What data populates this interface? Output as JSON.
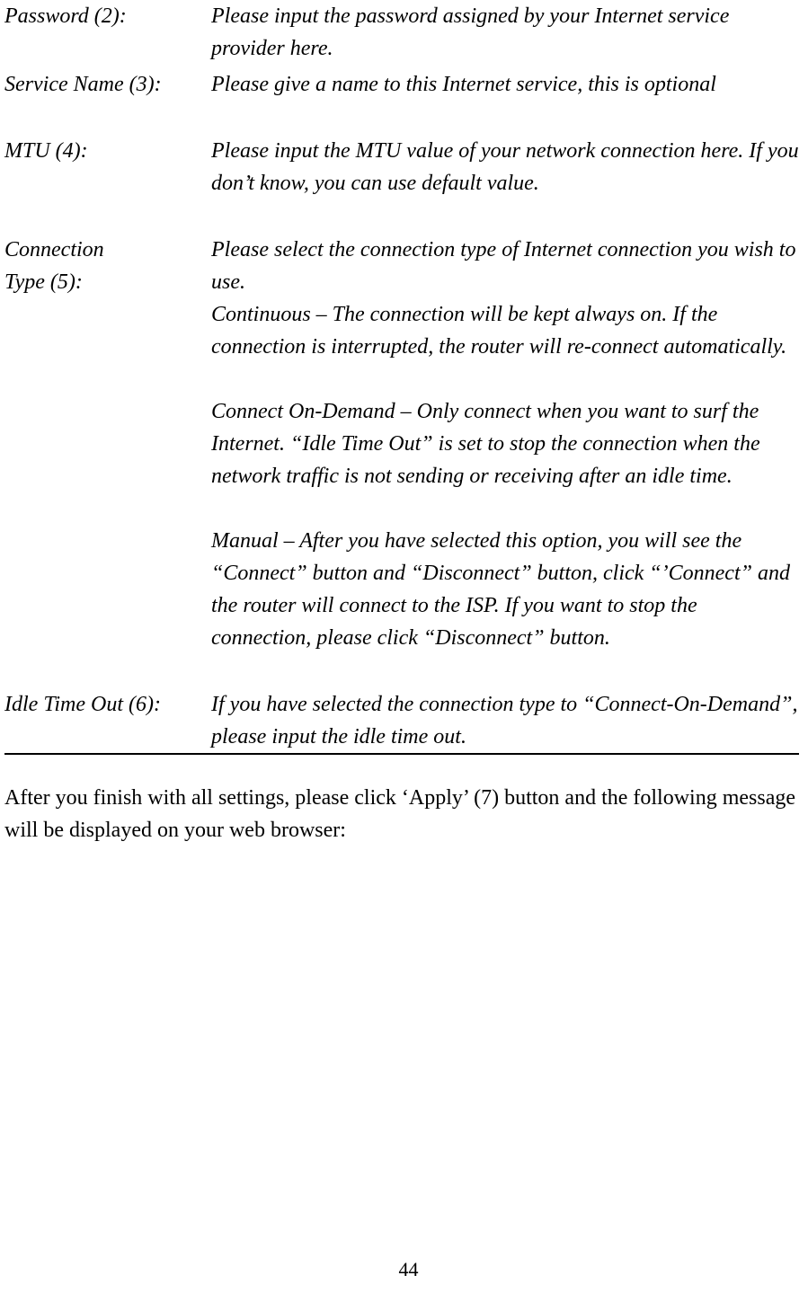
{
  "rows": {
    "password": {
      "label": "Password (2):",
      "desc": "Please input the password assigned by your Internet service provider here."
    },
    "service_name": {
      "label": "Service Name (3):",
      "desc": "Please give a name to this Internet service, this is optional"
    },
    "mtu": {
      "label": "MTU (4):",
      "desc": "Please input the MTU value of your network connection here. If you don’t know, you can use default value."
    },
    "connection_type": {
      "label_line1": "Connection",
      "label_line2": "Type (5):",
      "p1": "Please select the connection type of Internet connection you wish to use.",
      "p2": "Continuous – The connection will be kept always on. If the connection is interrupted, the router will re-connect automatically.",
      "p3": "Connect On-Demand – Only connect when you want to surf the Internet. “Idle Time Out” is set to stop the connection when the network traffic is not sending or receiving after an idle time.",
      "p4": "Manual – After you have selected this option, you will see the “Connect” button and “Disconnect” button, click “’Connect” and the router will connect to the ISP. If you want to stop the connection, please click “Disconnect” button."
    },
    "idle_time_out": {
      "label": "Idle Time Out (6):",
      "desc": "If you have selected the connection type to “Connect-On-Demand”, please input the idle time out."
    }
  },
  "after_text": "After you finish with all settings, please click ‘Apply’ (7) button and the following message will be displayed on your web browser:",
  "page_number": "44"
}
